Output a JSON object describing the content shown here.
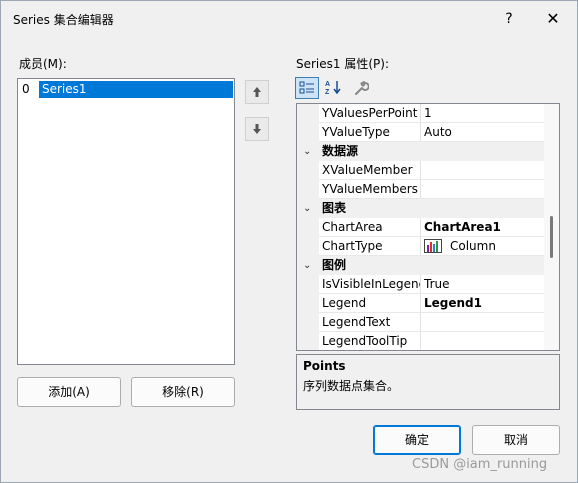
{
  "window": {
    "title": "Series 集合编辑器",
    "help_glyph": "?",
    "close_glyph": "✕"
  },
  "members": {
    "label": "成员(M):",
    "items": [
      {
        "index": "0",
        "name": "Series1",
        "selected": true
      }
    ],
    "move_up_glyph": "🡅",
    "move_down_glyph": "🡇"
  },
  "properties": {
    "label": "Series1 属性(P):",
    "toolbar": {
      "categorized_icon": "categorized-icon",
      "alphabetical_icon": "alphabetical-icon",
      "property_pages_icon": "wrench-icon"
    },
    "rows": [
      {
        "type": "prop",
        "name": "YValuesPerPoint",
        "value": "1",
        "bold": false
      },
      {
        "type": "prop",
        "name": "YValueType",
        "value": "Auto",
        "bold": false
      },
      {
        "type": "cat",
        "name": "数据源",
        "toggle": "⌄"
      },
      {
        "type": "prop",
        "name": "XValueMember",
        "value": "",
        "bold": false
      },
      {
        "type": "prop",
        "name": "YValueMembers",
        "value": "",
        "bold": false
      },
      {
        "type": "cat",
        "name": "图表",
        "toggle": "⌄"
      },
      {
        "type": "prop",
        "name": "ChartArea",
        "value": "ChartArea1",
        "bold": true
      },
      {
        "type": "prop",
        "name": "ChartType",
        "value": "Column",
        "bold": false,
        "icon": "column-chart-icon"
      },
      {
        "type": "cat",
        "name": "图例",
        "toggle": "⌄"
      },
      {
        "type": "prop",
        "name": "IsVisibleInLegend",
        "value": "True",
        "bold": false
      },
      {
        "type": "prop",
        "name": "Legend",
        "value": "Legend1",
        "bold": true
      },
      {
        "type": "prop",
        "name": "LegendText",
        "value": "",
        "bold": false
      },
      {
        "type": "prop",
        "name": "LegendToolTip",
        "value": "",
        "bold": false
      }
    ]
  },
  "description": {
    "title": "Points",
    "text": "序列数据点集合。"
  },
  "buttons": {
    "add": "添加(A)",
    "remove": "移除(R)",
    "ok": "确定",
    "cancel": "取消"
  },
  "watermark": "CSDN @iam_running"
}
